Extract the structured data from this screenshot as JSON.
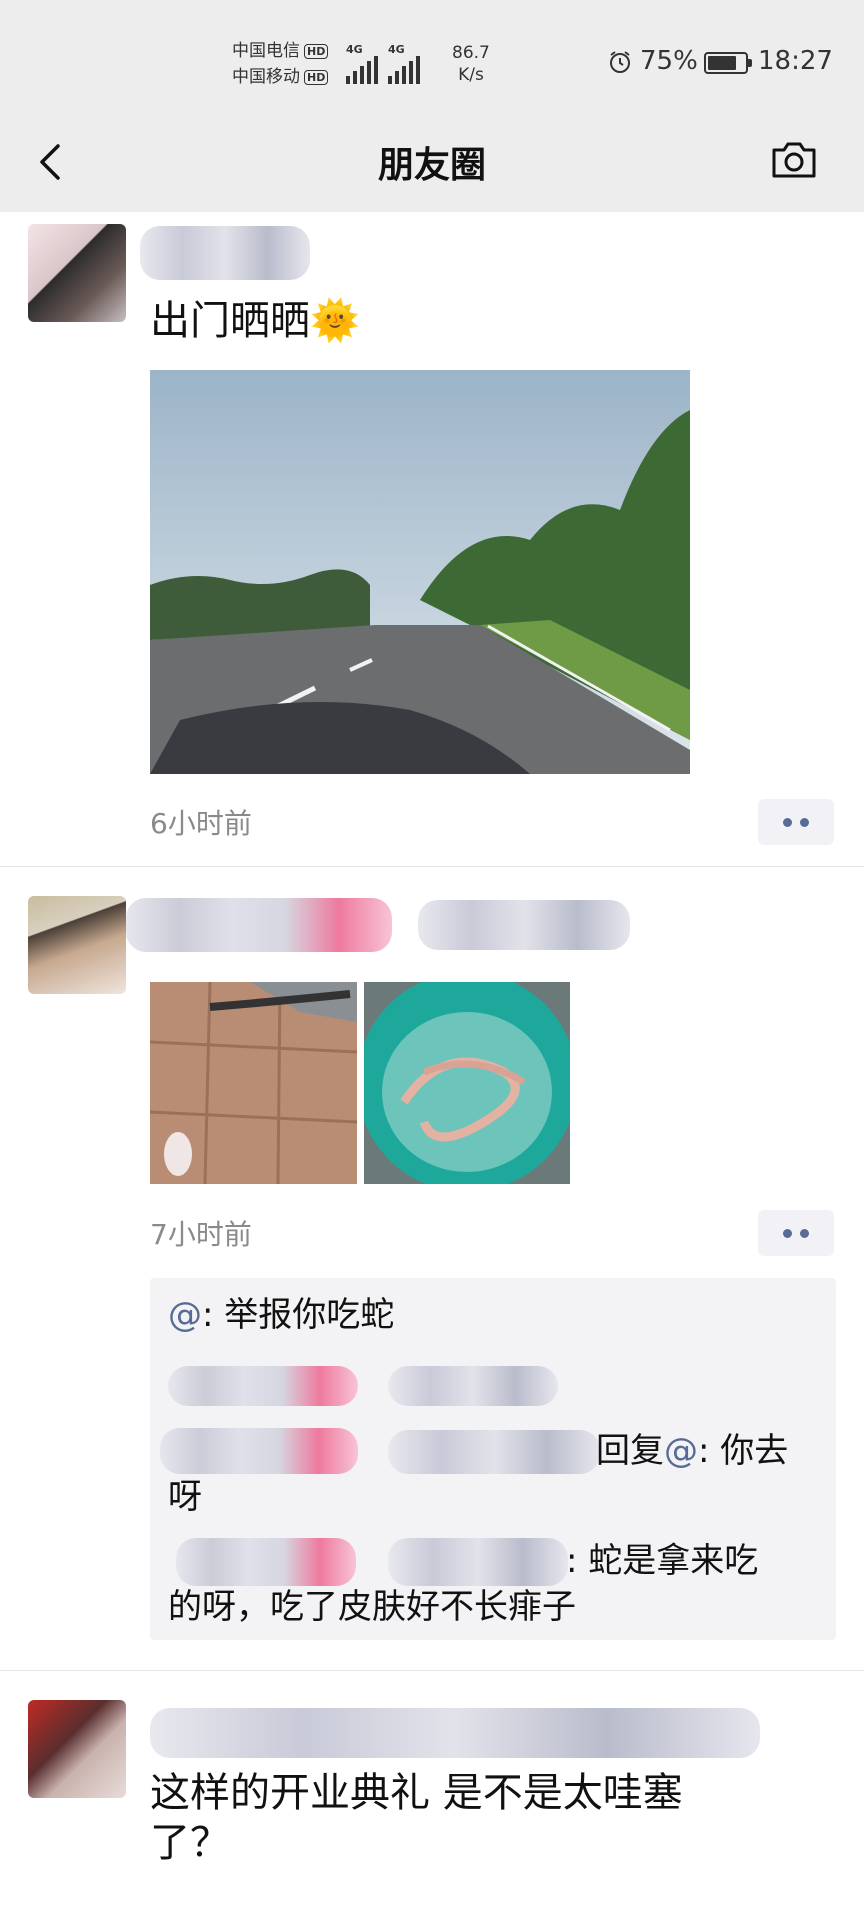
{
  "status_bar": {
    "carrier1": "中国电信",
    "carrier2": "中国移动",
    "hd_label": "HD",
    "network1": "4G",
    "network2": "4G",
    "speed_value": "86.7",
    "speed_unit": "K/s",
    "battery_percent": "75%",
    "battery_level": 0.75,
    "time": "18:27"
  },
  "nav": {
    "title": "朋友圈"
  },
  "posts": [
    {
      "text": "出门晒晒🌞",
      "time": "6小时前"
    },
    {
      "time": "7小时前",
      "comments": {
        "c1_at": "@",
        "c1_text": ": 举报你吃蛇",
        "c3_name_tail": "回复",
        "c3_at": "@",
        "c3_text": ": 你去",
        "c3_text2": "呀",
        "c4_text": ": 蛇是拿来吃",
        "c4_text2": "的呀，吃了皮肤好不长痱子"
      }
    },
    {
      "text": "这样的开业典礼  是不是太哇塞",
      "text2": "了？"
    }
  ]
}
